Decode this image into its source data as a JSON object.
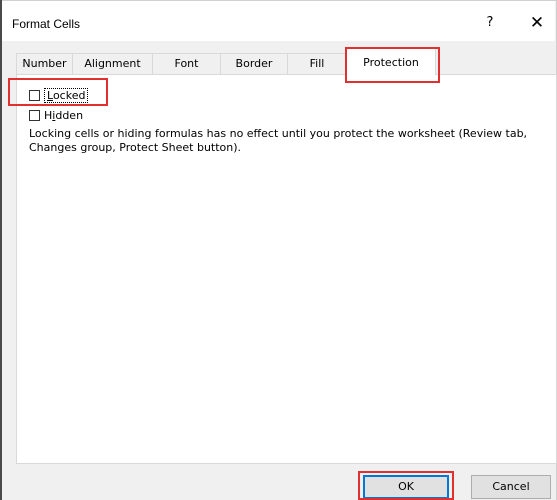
{
  "window": {
    "title": "Format Cells",
    "help": "?",
    "close": "✕"
  },
  "tabs": [
    {
      "label": "Number"
    },
    {
      "label": "Alignment"
    },
    {
      "label": "Font"
    },
    {
      "label": "Border"
    },
    {
      "label": "Fill"
    },
    {
      "label": "Protection",
      "active": true
    }
  ],
  "protection": {
    "locked": {
      "label_prefix": "",
      "label_underlined": "L",
      "label_rest": "ocked",
      "checked": false
    },
    "hidden": {
      "label_prefix": "H",
      "label_underlined": "i",
      "label_rest": "dden",
      "checked": false
    },
    "note": "Locking cells or hiding formulas has no effect until you protect the worksheet (Review tab, Changes group, Protect Sheet button)."
  },
  "buttons": {
    "ok": "OK",
    "cancel": "Cancel"
  },
  "colors": {
    "highlight": "#e03030",
    "focus_blue": "#0078d7"
  }
}
